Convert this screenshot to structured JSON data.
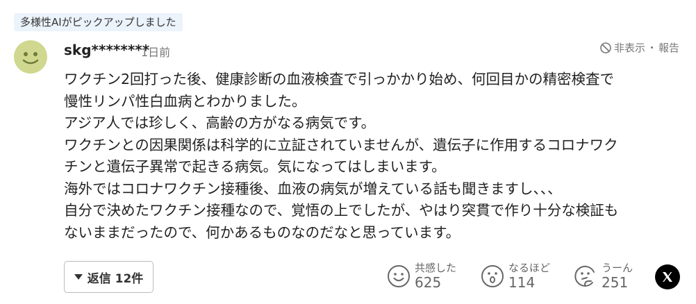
{
  "badge": {
    "text": "多様性AIがピックアップしました"
  },
  "comment": {
    "username": "skg********",
    "timestamp": "1日前",
    "report": {
      "hide_label": "非表示",
      "separator": "・",
      "report_label": "報告"
    },
    "body_lines": [
      "ワクチン2回打った後、健康診断の血液検査で引っかかり始め、何回目かの精密検査で",
      "慢性リンパ性白血病とわかりました。",
      "アジア人では珍しく、高齢の方がなる病気です。",
      "ワクチンとの因果関係は科学的に立証されていませんが、遺伝子に作用するコロナワク",
      "チンと遺伝子異常で起きる病気。気になってはしまいます。",
      "海外ではコロナワクチン接種後、血液の病気が増えている話も聞きますし、、、",
      "自分で決めたワクチン接種なので、覚悟の上でしたが、やはり突貫で作り十分な検証も",
      "ないままだったので、何かあるものなのだなと思っています。"
    ]
  },
  "reply": {
    "label": "返信 12件"
  },
  "reactions": [
    {
      "name": "empathy",
      "label": "共感した",
      "count": "625",
      "icon": "smile-face-icon"
    },
    {
      "name": "understood",
      "label": "なるほど",
      "count": "114",
      "icon": "surprised-face-icon"
    },
    {
      "name": "hmm",
      "label": "うーん",
      "count": "251",
      "icon": "thinking-face-icon"
    }
  ],
  "share": {
    "icon": "x-logo-icon"
  },
  "colors": {
    "avatar": "#cfd88e",
    "badge_bg": "#ebf3fb",
    "text": "#222222",
    "muted": "#777777"
  }
}
